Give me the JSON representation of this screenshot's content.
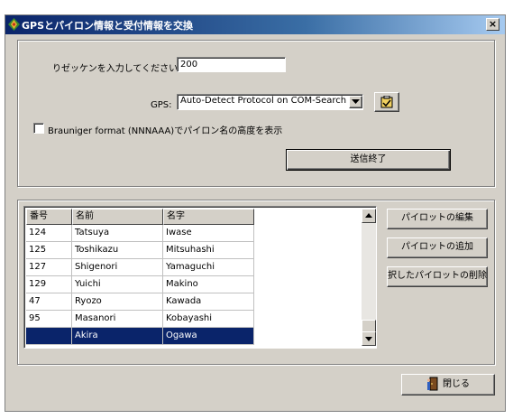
{
  "window": {
    "title": "GPSとパイロン情報と受付情報を交換",
    "close_label": "×"
  },
  "top": {
    "zeccken_label": "りゼッケンを入力してください",
    "zeccken_value": "200",
    "gps_label": "GPS:",
    "gps_selected": "Auto-Detect Protocol on COM-Search",
    "brauniger_label": "Brauniger format (NNNAAA)でパイロン名の高度を表示",
    "send_label": "送信終了"
  },
  "table": {
    "columns": [
      "番号",
      "名前",
      "名字"
    ],
    "rows": [
      [
        "124",
        "Tatsuya",
        "Iwase"
      ],
      [
        "125",
        "Toshikazu",
        "Mitsuhashi"
      ],
      [
        "127",
        "Shigenori",
        "Yamaguchi"
      ],
      [
        "129",
        "Yuichi",
        "Makino"
      ],
      [
        "47",
        "Ryozo",
        "Kawada"
      ],
      [
        "95",
        "Masanori",
        "Kobayashi"
      ],
      [
        "",
        "Akira",
        "Ogawa"
      ]
    ],
    "selected_row": 6
  },
  "buttons": {
    "edit": "パイロットの編集",
    "add": "パイロットの追加",
    "delete": "選択したパイロットの削除",
    "close": "閉じる"
  },
  "colors": {
    "title_start": "#0a246a",
    "title_end": "#a6caf0",
    "face": "#d4d0c8",
    "selection": "#0a246a"
  },
  "icons": [
    "app-icon",
    "close-icon",
    "gps-config-icon",
    "dropdown-arrow-icon",
    "scroll-up-icon",
    "scroll-down-icon",
    "door-exit-icon"
  ]
}
